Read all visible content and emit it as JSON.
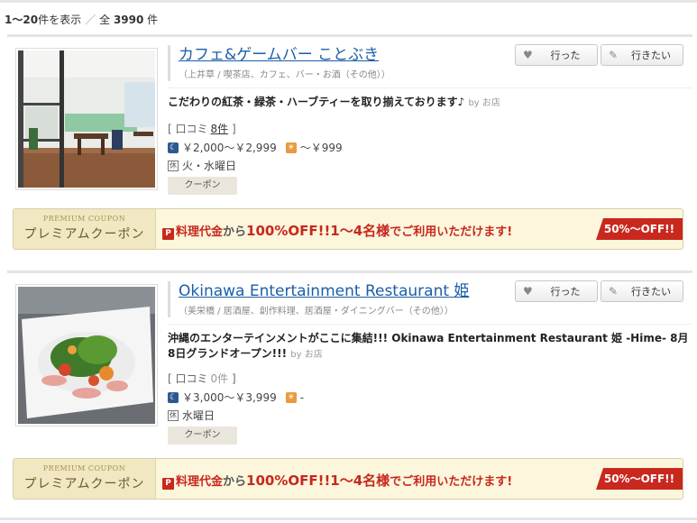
{
  "results": {
    "range": "1～20",
    "range_suffix": "件を表示",
    "separator": "／",
    "total_prefix": "全",
    "total": "3990",
    "total_suffix": "件"
  },
  "buttons": {
    "went_label": "行った",
    "want_label": "行きたい"
  },
  "restaurants": [
    {
      "name": "カフェ&ゲームバー ことぶき",
      "area": "（上井草 / 喫茶店、カフェ、バー・お酒（その他））",
      "catch": "こだわりの紅茶・緑茶・ハーブティーを取り揃えております♪",
      "by": "by お店",
      "reviews_label": "口コミ",
      "reviews_count": "8件",
      "night_price": "￥2,000～￥2,999",
      "lunch_price": "～￥999",
      "holiday": "火・水曜日",
      "coupon": "クーポン"
    },
    {
      "name": "Okinawa Entertainment Restaurant 姫",
      "area": "（美栄橋 / 居酒屋、創作料理、居酒屋・ダイニングバー（その他））",
      "catch": "沖縄のエンターテインメントがここに集結!!! Okinawa Entertainment Restaurant 姫 -Hime- 8月8日グランドオープン!!!",
      "by": "by お店",
      "reviews_label": "口コミ",
      "reviews_count": "0件",
      "night_price": "￥3,000～￥3,999",
      "lunch_price": "-",
      "holiday": "水曜日",
      "coupon": "クーポン"
    }
  ],
  "banner": {
    "en": "PREMIUM COUPON",
    "jp": "プレミアムクーポン",
    "text_a": "料理代金",
    "text_b": "から",
    "text_c": "100%OFF!!1～4名様",
    "text_d": "でご利用いただけます!",
    "ribbon": "50%～OFF!!"
  },
  "icons": {
    "went": "heart-icon",
    "want": "pin-icon",
    "night": "moon-icon",
    "lunch": "sun-icon",
    "holiday": "holiday-icon",
    "premium": "premium-p-icon"
  },
  "colors": {
    "link": "#1a5ea8",
    "accent_red": "#c8281e",
    "banner_bg": "#fbf6dc"
  }
}
